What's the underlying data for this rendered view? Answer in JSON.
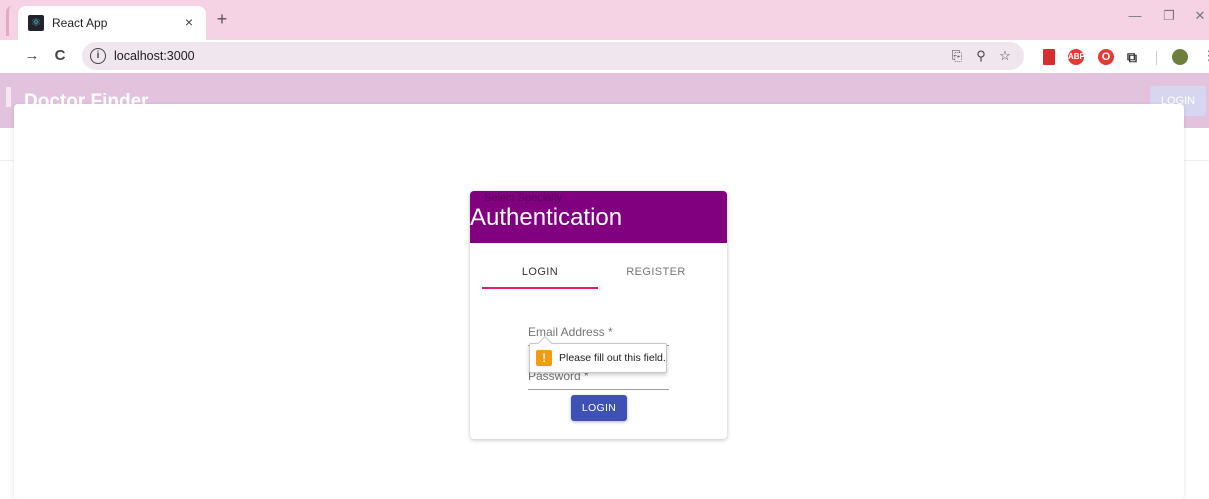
{
  "browser": {
    "tab_title": "React App",
    "tab_close": "×",
    "new_tab": "+",
    "favicon": "⚛",
    "window_controls": {
      "minimize": "—",
      "restore": "❐",
      "close": "✕"
    },
    "url": "localhost:3000",
    "nav": {
      "forward": "→",
      "reload": "C"
    },
    "omnibox_icons": {
      "install": "⎘",
      "zoom": "⚲",
      "bookmark": "☆"
    },
    "extensions": [
      {
        "name": "book-extension",
        "label": "",
        "color": "#d32f2f"
      },
      {
        "name": "adblock-extension",
        "label": "ABP",
        "color": "#e53935"
      },
      {
        "name": "opera-extension",
        "label": "O",
        "color": "#e53935"
      }
    ],
    "puzzle_icon": "⧉"
  },
  "app": {
    "title": "Doctor Finder",
    "login_button": "LOGIN"
  },
  "card": {
    "faint_text": "Select Specialty",
    "title": "Authentication",
    "tabs": [
      {
        "label": "LOGIN",
        "active": true
      },
      {
        "label": "REGISTER",
        "active": false
      }
    ],
    "email_label": "Email Address *",
    "password_label": "Password *",
    "submit_label": "LOGIN"
  },
  "validation": {
    "icon": "!",
    "message": "Please fill out this field."
  },
  "colors": {
    "header": "#800080",
    "tab_indicator": "#e91e63",
    "primary_button": "#3f51b5",
    "appbar": "#e2c2dd"
  }
}
